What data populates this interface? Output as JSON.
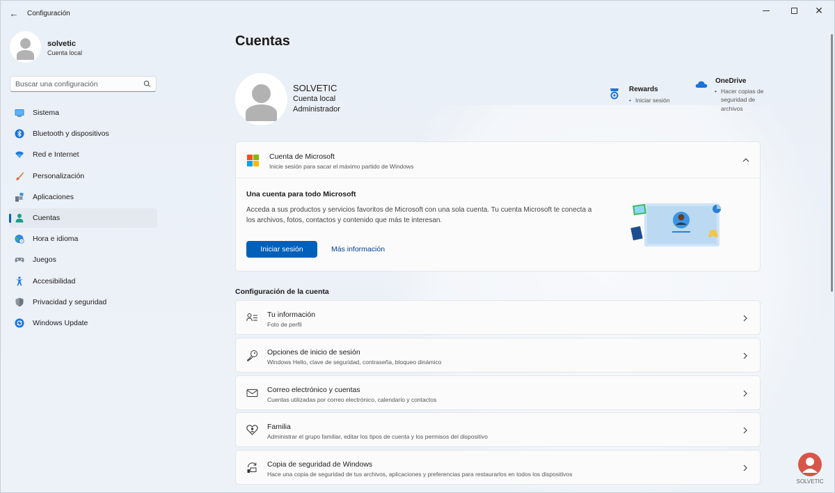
{
  "window": {
    "title": "Configuración"
  },
  "profile": {
    "name": "solvetic",
    "account_type": "Cuenta local"
  },
  "search": {
    "placeholder": "Buscar una configuración"
  },
  "sidebar": {
    "items": [
      {
        "label": "Sistema",
        "icon": "system-icon",
        "active": false
      },
      {
        "label": "Bluetooth y dispositivos",
        "icon": "bluetooth-icon",
        "active": false
      },
      {
        "label": "Red e Internet",
        "icon": "wifi-icon",
        "active": false
      },
      {
        "label": "Personalización",
        "icon": "brush-icon",
        "active": false
      },
      {
        "label": "Aplicaciones",
        "icon": "apps-icon",
        "active": false
      },
      {
        "label": "Cuentas",
        "icon": "person-icon",
        "active": true
      },
      {
        "label": "Hora e idioma",
        "icon": "globe-clock-icon",
        "active": false
      },
      {
        "label": "Juegos",
        "icon": "gamepad-icon",
        "active": false
      },
      {
        "label": "Accesibilidad",
        "icon": "accessibility-icon",
        "active": false
      },
      {
        "label": "Privacidad y seguridad",
        "icon": "shield-icon",
        "active": false
      },
      {
        "label": "Windows Update",
        "icon": "update-icon",
        "active": false
      }
    ]
  },
  "main": {
    "page_title": "Cuentas",
    "account": {
      "name": "SOLVETIC",
      "type": "Cuenta local",
      "role": "Administrador"
    },
    "rewards": {
      "title": "Rewards",
      "sub": "Iniciar sesión"
    },
    "onedrive": {
      "title": "OneDrive",
      "sub": "Hacer copias de seguridad de archivos"
    },
    "microsoft_card": {
      "title": "Cuenta de Microsoft",
      "subtitle": "Inicie sesión para sacar el máximo partido de Windows",
      "body_title": "Una cuenta para todo Microsoft",
      "body_desc": "Acceda a sus productos y servicios favoritos de Microsoft con una sola cuenta. Tu cuenta Microsoft te conecta a los archivos, fotos, contactos y contenido que más te interesan.",
      "signin_label": "Iniciar sesión",
      "more_label": "Más información"
    },
    "section_title": "Configuración de la cuenta",
    "settings": [
      {
        "title": "Tu información",
        "sub": "Foto de perfil",
        "icon": "person-card-icon"
      },
      {
        "title": "Opciones de inicio de sesión",
        "sub": "Windows Hello, clave de seguridad, contraseña, bloqueo dinámico",
        "icon": "key-icon"
      },
      {
        "title": "Correo electrónico y cuentas",
        "sub": "Cuentas utilizadas por correo electrónico, calendario y contactos",
        "icon": "mail-icon"
      },
      {
        "title": "Familia",
        "sub": "Administrar el grupo familiar, editar los tipos de cuenta y los permisos del dispositivo",
        "icon": "family-heart-icon"
      },
      {
        "title": "Copia de seguridad de Windows",
        "sub": "Hace una copia de seguridad de tus archivos, aplicaciones y preferencias para restaurarlos en todos los dispositivos",
        "icon": "backup-icon"
      }
    ]
  },
  "watermark": {
    "text": "SOLVETIC"
  },
  "colors": {
    "accent": "#005fb8",
    "link": "#003e92",
    "background": "#eef2f7"
  }
}
